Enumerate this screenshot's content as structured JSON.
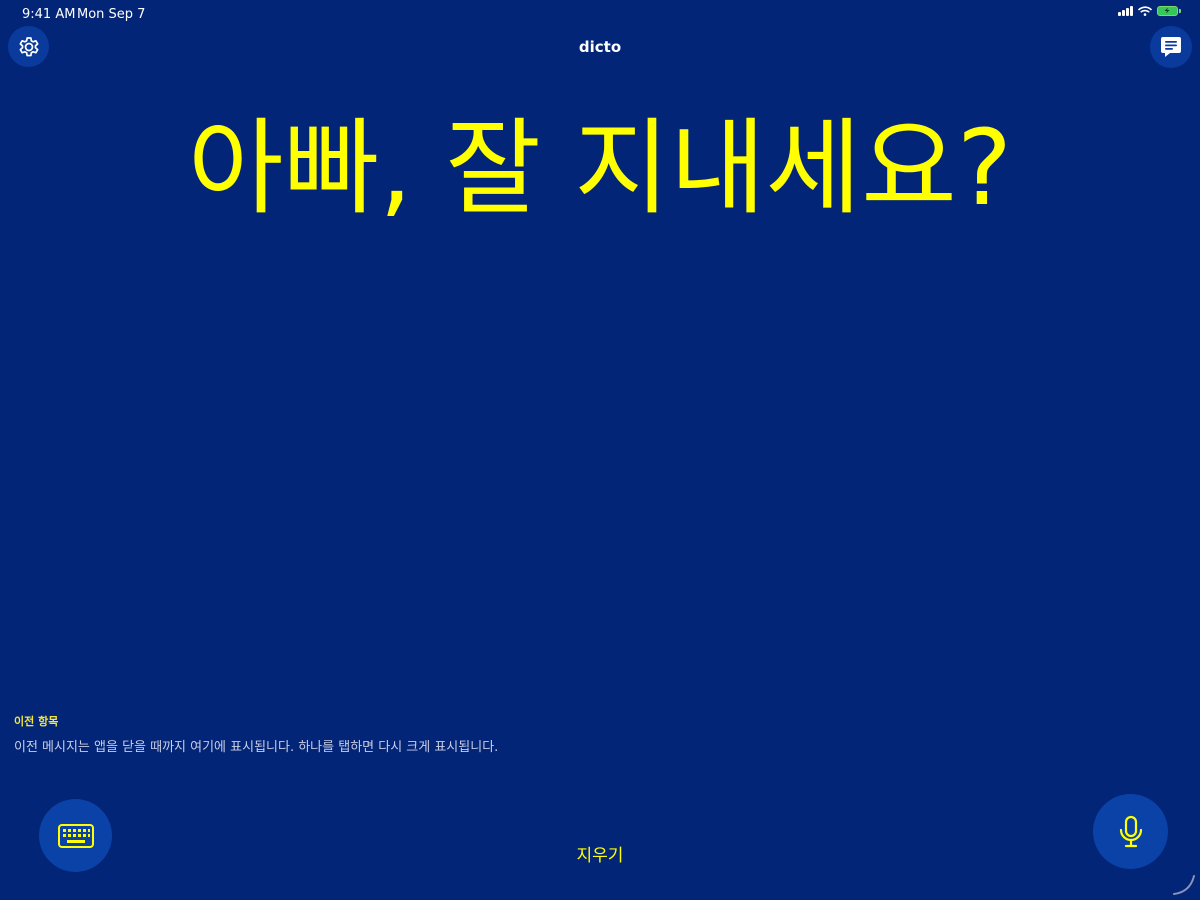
{
  "status_bar": {
    "time": "9:41 AM",
    "date": "Mon Sep 7"
  },
  "nav": {
    "title": "dicto",
    "settings_icon": "gear-icon",
    "chat_icon": "chat-bubble-icon"
  },
  "main": {
    "message": "아빠, 잘 지내세요?"
  },
  "history": {
    "heading": "이전 항목",
    "hint": "이전 메시지는 앱을 닫을 때까지 여기에 표시됩니다. 하나를 탭하면 다시 크게 표시됩니다."
  },
  "bottom": {
    "clear_label": "지우기",
    "keyboard_icon": "keyboard-icon",
    "mic_icon": "microphone-icon"
  },
  "colors": {
    "background": "#022577",
    "accent": "#ffff00",
    "button": "#0b42a8"
  }
}
